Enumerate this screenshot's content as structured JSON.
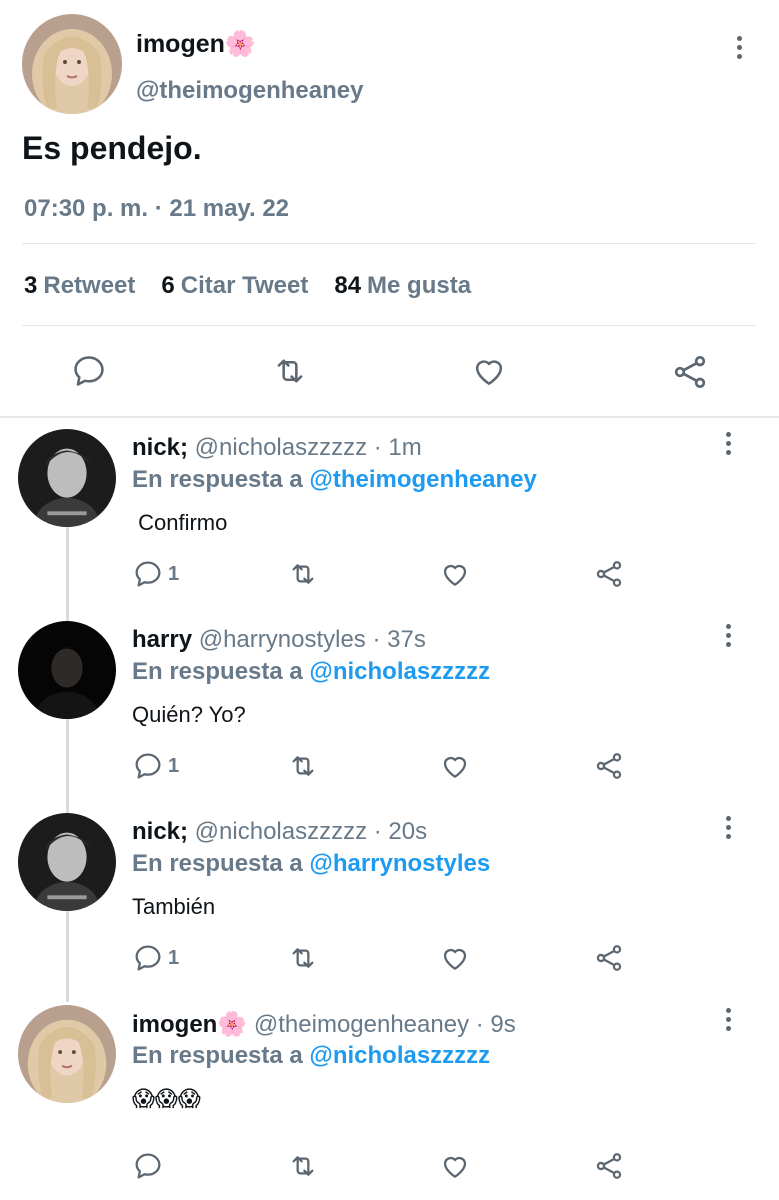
{
  "main_tweet": {
    "name": "imogen🌸",
    "handle": "@theimogenheaney",
    "text": "Es pendejo.",
    "timestamp": "07:30 p. m. · 21 may. 22",
    "stats": [
      {
        "count": "3",
        "label": "Retweet"
      },
      {
        "count": "6",
        "label": "Citar Tweet"
      },
      {
        "count": "84",
        "label": "Me gusta"
      }
    ]
  },
  "replies": [
    {
      "name": "nick;",
      "meta": " @nicholaszzzzz · 1m",
      "reply_prefix": "En respuesta a ",
      "mention": "@theimogenheaney",
      "text": " Confirmo",
      "reply_count": "1",
      "avatar": "dark"
    },
    {
      "name": "harry",
      "meta": " @harrynostyles · 37s",
      "reply_prefix": "En respuesta a ",
      "mention": "@nicholaszzzzz",
      "text": "Quién? Yo?",
      "reply_count": "1",
      "avatar": "black"
    },
    {
      "name": "nick;",
      "meta": " @nicholaszzzzz · 20s",
      "reply_prefix": "En respuesta a ",
      "mention": "@harrynostyles",
      "text": "También",
      "reply_count": "1",
      "avatar": "dark"
    },
    {
      "name": "imogen🌸",
      "meta": " @theimogenheaney · 9s",
      "reply_prefix": "En respuesta a ",
      "mention": "@nicholaszzzzz",
      "text": "😱😱😱",
      "reply_count": "",
      "avatar": "light"
    }
  ],
  "colors": {
    "text": "#0f1419",
    "secondary": "#687a89",
    "mention": "#1d9bf0",
    "icon": "#5b6670"
  },
  "icons": [
    "reply-icon",
    "retweet-icon",
    "like-icon",
    "share-icon",
    "more-icon"
  ]
}
